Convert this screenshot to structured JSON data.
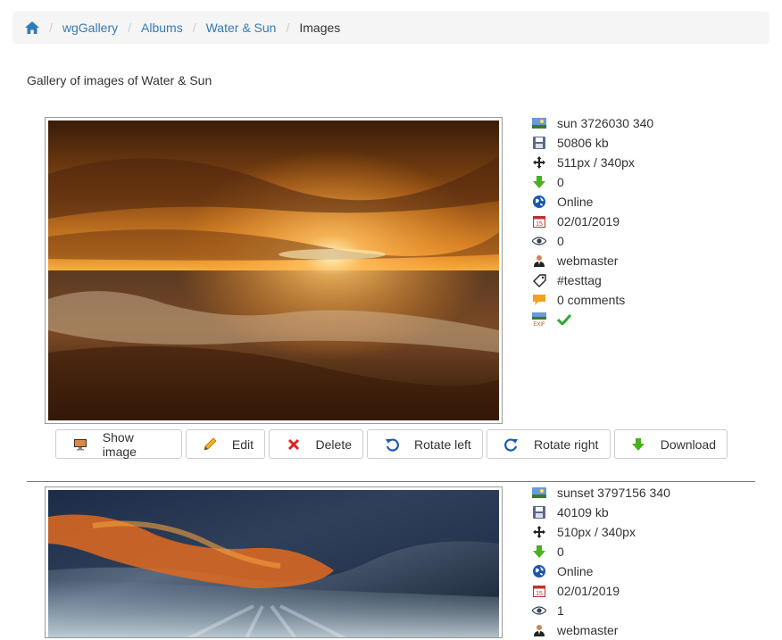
{
  "breadcrumb": {
    "items": [
      "wgGallery",
      "Albums",
      "Water & Sun"
    ],
    "current": "Images"
  },
  "intro": "Gallery of images of Water & Sun",
  "images": [
    {
      "title": "sun 3726030 340",
      "size": "50806 kb",
      "dimensions": "511px / 340px",
      "downloads": "0",
      "status": "Online",
      "date": "02/01/2019",
      "views": "0",
      "submitter": "webmaster",
      "tags": "#testtag",
      "comments": "0 comments",
      "exif_icon": "exif-icon",
      "exif_state_icon": "check-icon"
    },
    {
      "title": "sunset 3797156 340",
      "size": "40109 kb",
      "dimensions": "510px / 340px",
      "downloads": "0",
      "status": "Online",
      "date": "02/01/2019",
      "views": "1",
      "submitter": "webmaster"
    }
  ],
  "buttons": {
    "show_image": "Show image",
    "edit": "Edit",
    "delete": "Delete",
    "rotate_left": "Rotate left",
    "rotate_right": "Rotate right",
    "download": "Download"
  },
  "colors": {
    "link": "#337ab7",
    "breadcrumb_bg": "#f5f5f5",
    "check": "#2ea82e",
    "delete": "#e02020",
    "download": "#4caf20"
  }
}
